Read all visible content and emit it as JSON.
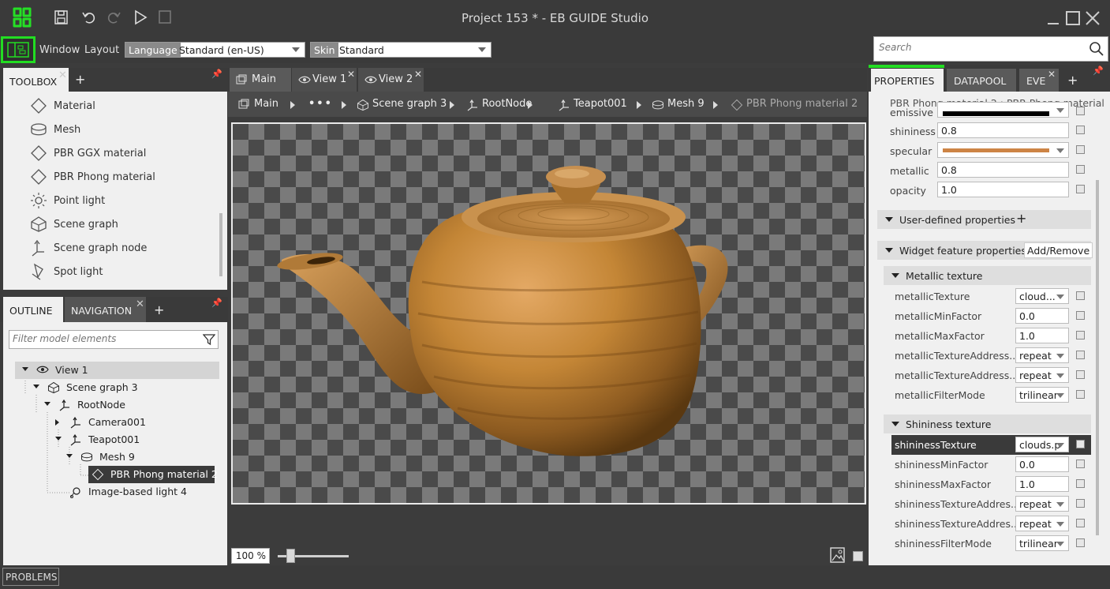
{
  "window": {
    "title": "Project 153 * - EB GUIDE Studio"
  },
  "menu": {
    "window": "Window",
    "layout": "Layout"
  },
  "language": {
    "tag": "Language",
    "value": "Standard (en-US)"
  },
  "skin": {
    "tag": "Skin",
    "value": "Standard"
  },
  "search": {
    "placeholder": "Search"
  },
  "toolbox": {
    "tab": "TOOLBOX",
    "items": [
      {
        "label": "Material",
        "icon": "material-icon"
      },
      {
        "label": "Mesh",
        "icon": "mesh-icon"
      },
      {
        "label": "PBR GGX material",
        "icon": "material-icon"
      },
      {
        "label": "PBR Phong material",
        "icon": "material-icon"
      },
      {
        "label": "Point light",
        "icon": "point-light-icon"
      },
      {
        "label": "Scene graph",
        "icon": "scene-graph-icon"
      },
      {
        "label": "Scene graph node",
        "icon": "scene-graph-node-icon"
      },
      {
        "label": "Spot light",
        "icon": "spot-light-icon"
      }
    ]
  },
  "outline": {
    "tab_outline": "OUTLINE",
    "tab_navigation": "NAVIGATION",
    "filter_placeholder": "Filter model elements",
    "tree": [
      {
        "label": "View 1",
        "icon": "eye-icon"
      },
      {
        "label": "Scene graph 3",
        "icon": "scene-graph-icon"
      },
      {
        "label": "RootNode",
        "icon": "node-icon"
      },
      {
        "label": "Camera001",
        "icon": "node-icon"
      },
      {
        "label": "Teapot001",
        "icon": "node-icon"
      },
      {
        "label": "Mesh 9",
        "icon": "mesh-icon"
      },
      {
        "label": "PBR Phong material 2",
        "icon": "material-icon"
      },
      {
        "label": "Image-based light 4",
        "icon": "image-light-icon"
      }
    ]
  },
  "center": {
    "tabs": [
      "Main",
      "View 1",
      "View 2"
    ],
    "breadcrumb": [
      "Main",
      "•••",
      "Scene graph 3",
      "RootNode",
      "Teapot001",
      "Mesh 9",
      "PBR Phong material 2"
    ],
    "zoom": "100 %"
  },
  "properties": {
    "tabs": [
      "PROPERTIES",
      "DATAPOOL",
      "EVE"
    ],
    "header": "PBR Phong material 2 : PBR Phong material",
    "rows": [
      {
        "label": "emissive",
        "color": "#000000"
      },
      {
        "label": "shininess",
        "value": "0.8"
      },
      {
        "label": "specular",
        "color": "#cd8445"
      },
      {
        "label": "metallic",
        "value": "0.8"
      },
      {
        "label": "opacity",
        "value": "1.0"
      }
    ],
    "user_defined": "User-defined properties",
    "widget_features": "Widget feature properties",
    "add_remove": "Add/Remove",
    "metallic_section": "Metallic texture",
    "metallic_rows": [
      {
        "label": "metallicTexture",
        "value": "cloud...",
        "kind": "drop"
      },
      {
        "label": "metallicMinFactor",
        "value": "0.0",
        "kind": "input"
      },
      {
        "label": "metallicMaxFactor",
        "value": "1.0",
        "kind": "input"
      },
      {
        "label": "metallicTextureAddress...",
        "value": "repeat",
        "kind": "drop"
      },
      {
        "label": "metallicTextureAddress...",
        "value": "repeat",
        "kind": "drop"
      },
      {
        "label": "metallicFilterMode",
        "value": "trilinear",
        "kind": "drop"
      }
    ],
    "shininess_section": "Shininess texture",
    "shininess_rows": [
      {
        "label": "shininessTexture",
        "value": "clouds.p",
        "kind": "drop"
      },
      {
        "label": "shininessMinFactor",
        "value": "0.0",
        "kind": "input"
      },
      {
        "label": "shininessMaxFactor",
        "value": "1.0",
        "kind": "input"
      },
      {
        "label": "shininessTextureAddres...",
        "value": "repeat",
        "kind": "drop"
      },
      {
        "label": "shininessTextureAddres...",
        "value": "repeat",
        "kind": "drop"
      },
      {
        "label": "shininessFilterMode",
        "value": "trilinear",
        "kind": "drop"
      }
    ]
  },
  "status": {
    "problems": "PROBLEMS"
  },
  "colors": {
    "accent": "#22dd22",
    "panel": "#f0f0f0",
    "chrome": "#3a3a3a"
  }
}
